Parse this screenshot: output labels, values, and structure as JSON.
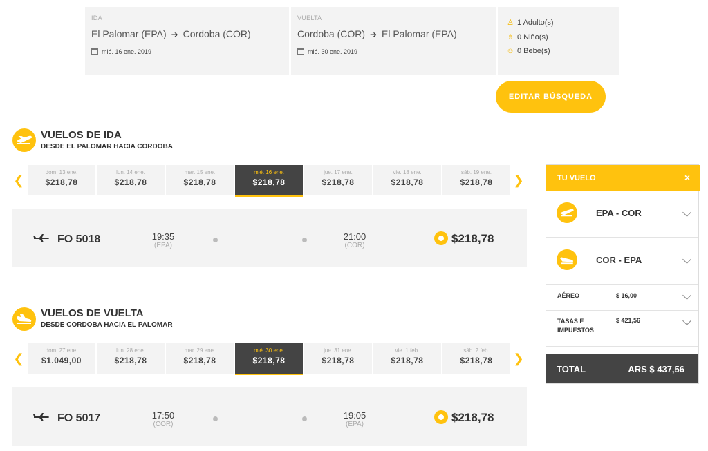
{
  "search": {
    "outbound": {
      "label": "IDA",
      "from": "El Palomar (EPA)",
      "to": "Cordoba (COR)",
      "date": "mié. 16 ene. 2019"
    },
    "return": {
      "label": "VUELTA",
      "from": "Cordoba (COR)",
      "to": "El Palomar (EPA)",
      "date": "mié. 30 ene. 2019"
    },
    "passengers": {
      "adults": "1 Adulto(s)",
      "children": "0 Niño(s)",
      "infants": "0 Bebé(s)"
    },
    "edit_label": "EDITAR BÚSQUEDA"
  },
  "outbound_section": {
    "title": "VUELOS DE IDA",
    "subtitle": "DESDE EL PALOMAR HACIA CORDOBA",
    "days": [
      {
        "name": "dom. 13 ene.",
        "price": "$218,78"
      },
      {
        "name": "lun. 14 ene.",
        "price": "$218,78"
      },
      {
        "name": "mar. 15 ene.",
        "price": "$218,78"
      },
      {
        "name": "mié. 16 ene.",
        "price": "$218,78"
      },
      {
        "name": "jue. 17 ene.",
        "price": "$218,78"
      },
      {
        "name": "vie. 18 ene.",
        "price": "$218,78"
      },
      {
        "name": "sáb. 19 ene.",
        "price": "$218,78"
      }
    ],
    "selected_index": 3,
    "flight": {
      "number": "FO 5018",
      "dep_time": "19:35",
      "dep_code": "(EPA)",
      "arr_time": "21:00",
      "arr_code": "(COR)",
      "price": "$218,78"
    }
  },
  "return_section": {
    "title": "VUELOS DE VUELTA",
    "subtitle": "DESDE CORDOBA HACIA EL PALOMAR",
    "days": [
      {
        "name": "dom. 27 ene.",
        "price": "$1.049,00"
      },
      {
        "name": "lun. 28 ene.",
        "price": "$218,78"
      },
      {
        "name": "mar. 29 ene.",
        "price": "$218,78"
      },
      {
        "name": "mié. 30 ene.",
        "price": "$218,78"
      },
      {
        "name": "jue. 31 ene.",
        "price": "$218,78"
      },
      {
        "name": "vie. 1 feb.",
        "price": "$218,78"
      },
      {
        "name": "sáb. 2 feb.",
        "price": "$218,78"
      }
    ],
    "selected_index": 3,
    "flight": {
      "number": "FO 5017",
      "dep_time": "17:50",
      "dep_code": "(COR)",
      "arr_time": "19:05",
      "arr_code": "(EPA)",
      "price": "$218,78"
    }
  },
  "summary": {
    "title": "TU VUELO",
    "close": "×",
    "segments": [
      "EPA - COR",
      "COR - EPA"
    ],
    "air_label": "AÉREO",
    "air_value": "$ 16,00",
    "taxes_label_1": "TASAS E",
    "taxes_label_2": "IMPUESTOS",
    "taxes_value": "$ 421,56",
    "total_label": "TOTAL",
    "total_value": "ARS $ 437,56"
  },
  "colors": {
    "accent": "#ffc20e",
    "dark": "#444444",
    "panel": "#f3f3f3"
  }
}
